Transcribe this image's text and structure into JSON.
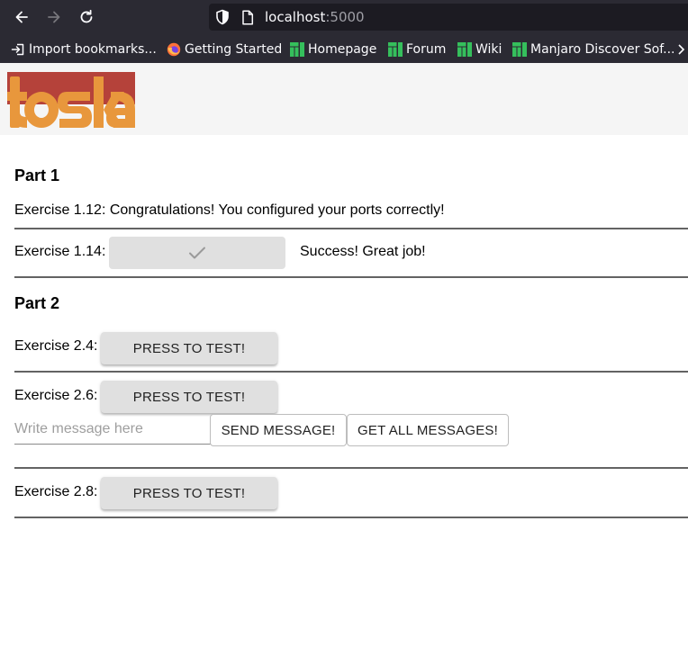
{
  "browser": {
    "url_host": "localhost",
    "url_port": ":5000",
    "bookmarks": [
      {
        "label": "Import bookmarks...",
        "icon": "import-icon"
      },
      {
        "label": "Getting Started",
        "icon": "firefox-icon"
      },
      {
        "label": "Homepage",
        "icon": "manjaro-icon"
      },
      {
        "label": "Forum",
        "icon": "manjaro-icon"
      },
      {
        "label": "Wiki",
        "icon": "manjaro-icon"
      },
      {
        "label": "Manjaro Discover Sof...",
        "icon": "manjaro-icon"
      }
    ],
    "colors": {
      "chrome": "#2b2a33",
      "urlbar": "#1c1b22",
      "manjaro": "#35bf5c"
    }
  },
  "header": {
    "logo_text": "toska",
    "colors": {
      "logo_orange": "#e8973c",
      "logo_red": "#b5423a"
    }
  },
  "part1": {
    "title": "Part 1",
    "ex112": {
      "text": "Exercise 1.12: Congratulations! You configured your ports correctly!"
    },
    "ex114": {
      "label": "Exercise 1.14:",
      "button_icon": "check-icon",
      "status": "Success! Great job!"
    }
  },
  "part2": {
    "title": "Part 2",
    "ex24": {
      "label": "Exercise 2.4:",
      "button": "PRESS TO TEST!"
    },
    "ex26": {
      "label": "Exercise 2.6:",
      "button": "PRESS TO TEST!",
      "input_placeholder": "Write message here",
      "send_button": "SEND MESSAGE!",
      "get_button": "GET ALL MESSAGES!"
    },
    "ex28": {
      "label": "Exercise 2.8:",
      "button": "PRESS TO TEST!"
    }
  }
}
